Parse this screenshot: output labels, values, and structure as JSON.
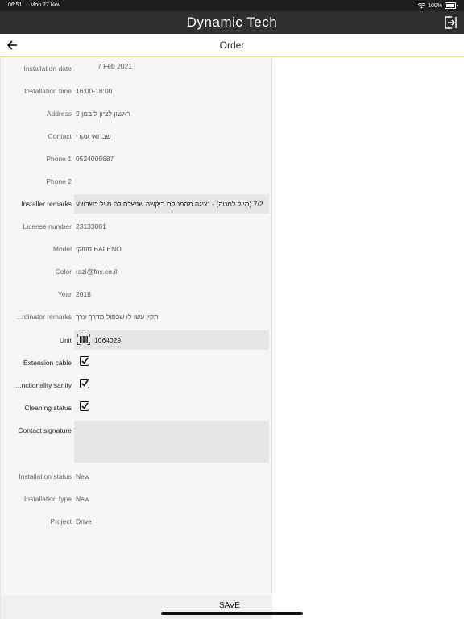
{
  "status_bar": {
    "time": "06:51",
    "date": "Mon 27 Nov",
    "battery": "100%"
  },
  "app": {
    "title": "Dynamic Tech"
  },
  "nav": {
    "title": "Order"
  },
  "fields": {
    "installation_date": {
      "label": "Installation date",
      "value": "7 Feb 2021"
    },
    "installation_time": {
      "label": "Installation time",
      "value": "16:00-18:00"
    },
    "address": {
      "label": "Address",
      "value": "ראשון לציון לובמן 9"
    },
    "contact": {
      "label": "Contact",
      "value": "שבתאי עקרי"
    },
    "phone1": {
      "label": "Phone 1",
      "value": "0524008687"
    },
    "phone2": {
      "label": "Phone 2",
      "value": ""
    },
    "installer_remarks": {
      "label": "Installer remarks",
      "value": "7/2 (מייל למטה) - נציגה מהפניקס ביקשה שנשלח לה מייל כשבוצע"
    },
    "license_number": {
      "label": "License number",
      "value": "23133001"
    },
    "model": {
      "label": "Model",
      "value": "סוזוקי BALENO"
    },
    "color": {
      "label": "Color",
      "value": "razi@fnx.co.il"
    },
    "year": {
      "label": "Year",
      "value": "2018"
    },
    "coordinator_remarks": {
      "label": "...rdinator remarks",
      "value": "תקין עשו לו שכפול מדרך ערך"
    },
    "unit": {
      "label": "Unit",
      "value": "1064029"
    },
    "extension_cable": {
      "label": "Extension cable",
      "checked": true
    },
    "functionality_sanity": {
      "label": "...nctionality sanity",
      "checked": true
    },
    "cleaning_status": {
      "label": "Cleaning status",
      "checked": true
    },
    "contact_signature": {
      "label": "Contact signature"
    },
    "installation_status": {
      "label": "Installation status",
      "value": "New"
    },
    "installation_type": {
      "label": "Installation type",
      "value": "New"
    },
    "project": {
      "label": "Project",
      "value": "Drive"
    }
  },
  "actions": {
    "save_label": "SAVE"
  },
  "icons": {
    "wifi": "wifi-icon",
    "battery": "battery-icon",
    "logout": "logout-icon",
    "back": "back-arrow-icon",
    "barcode": "barcode-scan-icon",
    "checkmark": "checkmark-icon"
  },
  "colors": {
    "app_bar": "#303030",
    "accent_line": "#f0cf8a",
    "panel": "#f6f6f6",
    "input_bg": "#e6e6e6"
  }
}
